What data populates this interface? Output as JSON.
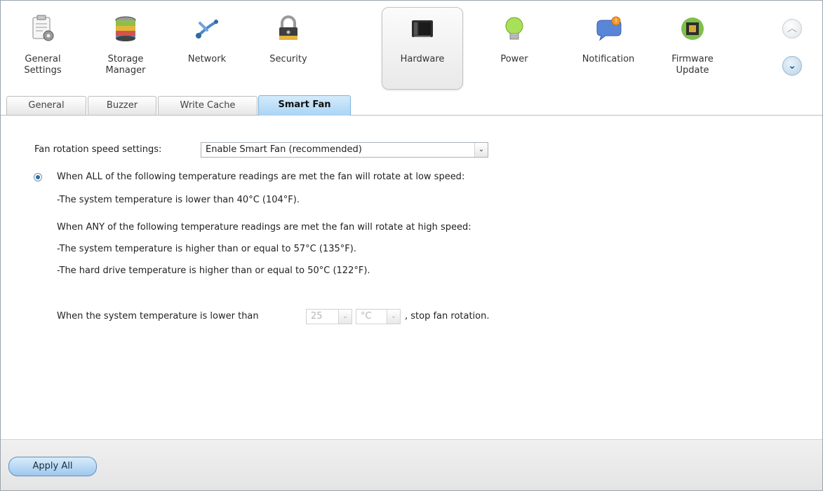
{
  "nav": {
    "items": [
      {
        "label_1": "General",
        "label_2": "Settings",
        "icon": "general-settings-icon"
      },
      {
        "label_1": "Storage",
        "label_2": "Manager",
        "icon": "storage-manager-icon"
      },
      {
        "label_1": "Network",
        "label_2": "",
        "icon": "network-icon"
      },
      {
        "label_1": "Security",
        "label_2": "",
        "icon": "security-lock-icon"
      },
      {
        "label_1": "Hardware",
        "label_2": "",
        "icon": "hardware-icon"
      },
      {
        "label_1": "Power",
        "label_2": "",
        "icon": "power-bulb-icon"
      },
      {
        "label_1": "Notification",
        "label_2": "",
        "icon": "notification-icon"
      },
      {
        "label_1": "Firmware",
        "label_2": "Update",
        "icon": "firmware-update-icon"
      }
    ],
    "active": "Hardware",
    "scroll_up_glyph": "︿",
    "scroll_down_glyph": "⌄"
  },
  "tabs": [
    {
      "label": "General"
    },
    {
      "label": "Buzzer"
    },
    {
      "label": "Write Cache"
    },
    {
      "label": "Smart Fan"
    }
  ],
  "active_tab": "Smart Fan",
  "smart_fan": {
    "speed_label": "Fan rotation speed settings:",
    "speed_value": "Enable Smart Fan (recommended)",
    "low_speed_heading": "When ALL of the following temperature readings are met the fan will rotate at low speed:",
    "low_speed_rule": "-The system temperature is lower than 40°C (104°F).",
    "high_speed_heading": "When ANY of the following temperature readings are met the fan will rotate at high speed:",
    "high_speed_rule_1": "-The system temperature is higher than or equal to 57°C (135°F).",
    "high_speed_rule_2": "-The hard drive temperature is higher than or equal to 50°C (122°F).",
    "stop_prefix": "When the system temperature is lower than",
    "stop_temp_value": "25",
    "stop_unit_value": "°C",
    "stop_suffix": ", stop fan rotation.",
    "dropdown_arrow": "⌄"
  },
  "footer": {
    "apply_label": "Apply All"
  },
  "colors": {
    "accent": "#aad4f5",
    "radio": "#2f6aa5"
  }
}
